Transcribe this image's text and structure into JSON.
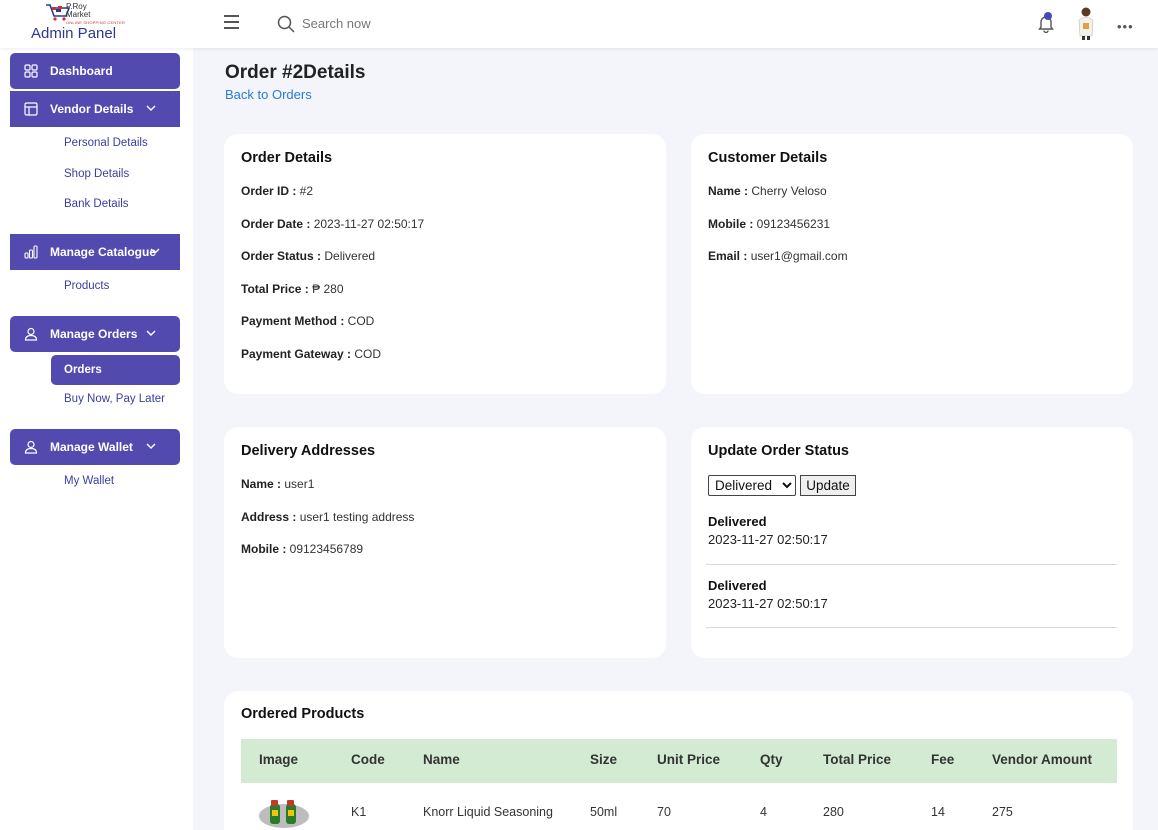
{
  "header": {
    "logo_line1": "P.Roy",
    "logo_line2": "Market",
    "logo_line3": "ONLINE SHOPPING CENTER",
    "admin_title": "Admin Panel",
    "search_placeholder": "Search now",
    "more_label": "•••"
  },
  "sidebar": {
    "dashboard": "Dashboard",
    "vendor_details": "Vendor Details",
    "personal_details": "Personal Details",
    "shop_details": "Shop Details",
    "bank_details": "Bank Details",
    "manage_catalogue": "Manage Catalogue",
    "products": "Products",
    "manage_orders": "Manage Orders",
    "orders": "Orders",
    "buy_now_pay_later": "Buy Now, Pay Later",
    "manage_wallet": "Manage Wallet",
    "my_wallet": "My Wallet"
  },
  "page": {
    "title": "Order #2Details",
    "back_link": "Back to Orders"
  },
  "order_details": {
    "title": "Order Details",
    "order_id_label": "Order ID :",
    "order_id": " #2",
    "order_date_label": "Order Date :",
    "order_date": " 2023-11-27 02:50:17",
    "order_status_label": "Order Status :",
    "order_status": " Delivered",
    "total_price_label": "Total Price :",
    "total_price": " ₱ 280",
    "payment_method_label": "Payment Method :",
    "payment_method": " COD",
    "payment_gateway_label": "Payment Gateway :",
    "payment_gateway": " COD"
  },
  "customer_details": {
    "title": "Customer Details",
    "name_label": "Name :",
    "name": " Cherry Veloso",
    "mobile_label": "Mobile :",
    "mobile": " 09123456231",
    "email_label": "Email :",
    "email": " user1@gmail.com"
  },
  "delivery": {
    "title": "Delivery Addresses",
    "name_label": "Name :",
    "name": " user1",
    "address_label": "Address :",
    "address": " user1 testing address",
    "mobile_label": "Mobile :",
    "mobile": " 09123456789"
  },
  "update_status": {
    "title": "Update Order Status",
    "selected": "Delivered",
    "update_button": "Update",
    "history": [
      {
        "status": "Delivered",
        "date": "2023-11-27 02:50:17"
      },
      {
        "status": "Delivered",
        "date": "2023-11-27 02:50:17"
      }
    ]
  },
  "ordered_products": {
    "title": "Ordered Products",
    "columns": [
      "Image",
      "Code",
      "Name",
      "Size",
      "Unit Price",
      "Qty",
      "Total Price",
      "Fee",
      "Vendor Amount"
    ],
    "rows": [
      {
        "code": "K1",
        "name": "Knorr Liquid Seasoning",
        "size": "50ml",
        "unit_price": "70",
        "qty": "4",
        "total_price": "280",
        "fee": "14",
        "vendor_amount": "275"
      }
    ]
  },
  "colors": {
    "accent": "#534ab0",
    "link": "#2a7bd1",
    "table_header": "#d3ebd3",
    "background": "#f3f5fb"
  }
}
